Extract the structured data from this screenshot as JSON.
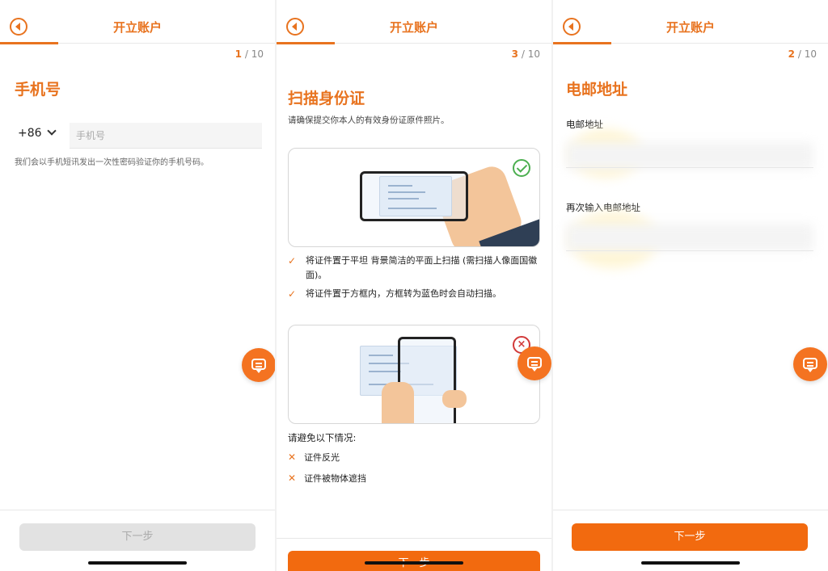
{
  "screens": [
    {
      "header_title": "开立账户",
      "step": {
        "current": "1",
        "total": "/ 10"
      },
      "section_title": "手机号",
      "country_code": "+86",
      "phone_placeholder": "手机号",
      "hint": "我们会以手机短讯发出一次性密码验证你的手机号码。",
      "next_button": "下一步",
      "next_enabled": false
    },
    {
      "header_title": "开立账户",
      "step": {
        "current": "3",
        "total": "/ 10"
      },
      "section_title": "扫描身份证",
      "subtitle": "请确保提交你本人的有效身份证原件照片。",
      "tips": [
        "将证件置于平坦 背景简洁的平面上扫描 (需扫描人像面国徽面)。",
        "将证件置于方框内，方框转为蓝色时会自动扫描。"
      ],
      "avoid_title": "请避免以下情况:",
      "avoid_items": [
        "证件反光",
        "证件被物体遮挡"
      ],
      "next_button": "下一步"
    },
    {
      "header_title": "开立账户",
      "step": {
        "current": "2",
        "total": "/ 10"
      },
      "section_title": "电邮地址",
      "email_label": "电邮地址",
      "confirm_email_label": "再次输入电邮地址",
      "next_button": "下一步"
    }
  ],
  "colors": {
    "accent": "#e8731f",
    "button": "#f26a0f",
    "success": "#4caf50",
    "error": "#d23a3a"
  },
  "icons": {
    "back": "back-arrow-icon",
    "chat": "chat-bubble-icon",
    "check": "check-icon",
    "cross": "cross-icon",
    "chevron": "chevron-down-icon"
  }
}
